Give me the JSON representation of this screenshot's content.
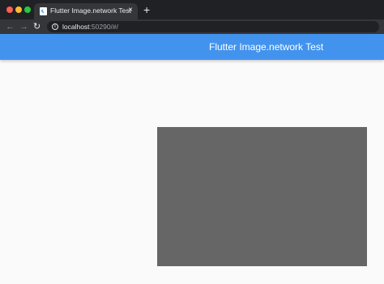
{
  "browser": {
    "tab": {
      "title": "Flutter Image.network Test",
      "favicon": "flutter-logo-icon",
      "close_label": "×"
    },
    "new_tab_label": "+",
    "nav": {
      "back_icon": "arrow-left-icon",
      "forward_icon": "arrow-right-icon",
      "reload_icon": "reload-icon"
    },
    "address": {
      "host": "localhost",
      "rest": ":50290/#/",
      "info_icon": "info-icon"
    },
    "traffic_lights": {
      "close": "#ff5f57",
      "minimize": "#febc2e",
      "maximize": "#28c840"
    }
  },
  "app": {
    "title": "Flutter Image.network Test",
    "accent": "#4293ee",
    "background": "#fafafa",
    "image_placeholder_color": "#666666"
  }
}
